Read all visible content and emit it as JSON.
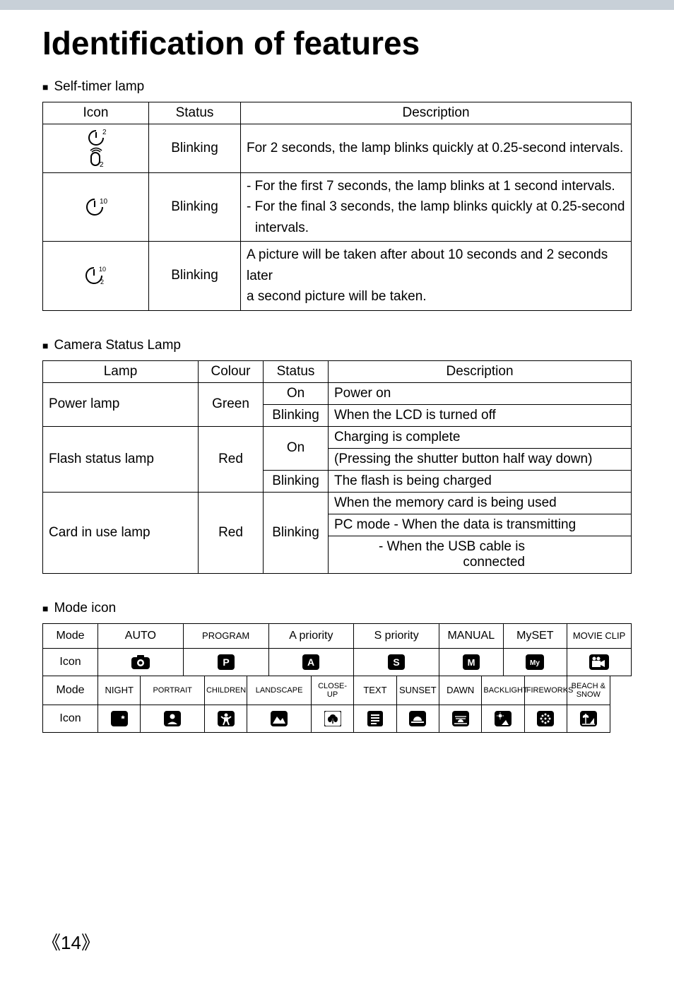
{
  "title": "Identification of features",
  "section1": {
    "heading": "Self-timer lamp",
    "headers": {
      "icon": "Icon",
      "status": "Status",
      "desc": "Description"
    },
    "rows": [
      {
        "status": "Blinking",
        "desc": "For 2 seconds, the lamp blinks quickly at 0.25-second intervals."
      },
      {
        "status": "Blinking",
        "l1": "- For the first 7 seconds, the lamp blinks at 1 second intervals.",
        "l2": "- For the final 3 seconds, the lamp blinks quickly at 0.25-second",
        "l3": "intervals."
      },
      {
        "status": "Blinking",
        "l1": "A picture will be taken after about 10 seconds and 2 seconds later",
        "l2": "a second picture will be taken."
      }
    ]
  },
  "section2": {
    "heading": "Camera Status Lamp",
    "headers": {
      "lamp": "Lamp",
      "colour": "Colour",
      "status": "Status",
      "desc": "Description"
    },
    "rows": {
      "power": {
        "lamp": "Power lamp",
        "colour": "Green",
        "r1": {
          "status": "On",
          "desc": "Power on"
        },
        "r2": {
          "status": "Blinking",
          "desc": "When the LCD is turned off"
        }
      },
      "flash": {
        "lamp": "Flash status lamp",
        "colour": "Red",
        "r1": {
          "status": "On",
          "d1": "Charging is complete",
          "d2": "(Pressing the shutter button half way down)"
        },
        "r2": {
          "status": "Blinking",
          "desc": "The flash is being charged"
        }
      },
      "card": {
        "lamp": "Card in use lamp",
        "colour": "Red",
        "status": "Blinking",
        "d1": "When the memory card is being used",
        "d2": "PC mode - When the data is transmitting",
        "d3": "- When the USB cable is connected"
      }
    }
  },
  "section3": {
    "heading": "Mode icon",
    "row1": {
      "label": "Mode",
      "c1": "AUTO",
      "c2": "PROGRAM",
      "c3": "A priority",
      "c4": "S priority",
      "c5": "MANUAL",
      "c6": "MySET",
      "c7": "MOVIE CLIP"
    },
    "row2": {
      "label": "Icon"
    },
    "row3": {
      "label": "Mode",
      "c1": "NIGHT",
      "c2": "PORTRAIT",
      "c3": "CHILDREN",
      "c4": "LANDSCAPE",
      "c5": "CLOSE-UP",
      "c6": "TEXT",
      "c7": "SUNSET",
      "c8": "DAWN",
      "c9": "BACKLIGHT",
      "c10": "FIREWORKS",
      "c11": "BEACH & SNOW"
    },
    "row4": {
      "label": "Icon"
    }
  },
  "pagenum": "14"
}
